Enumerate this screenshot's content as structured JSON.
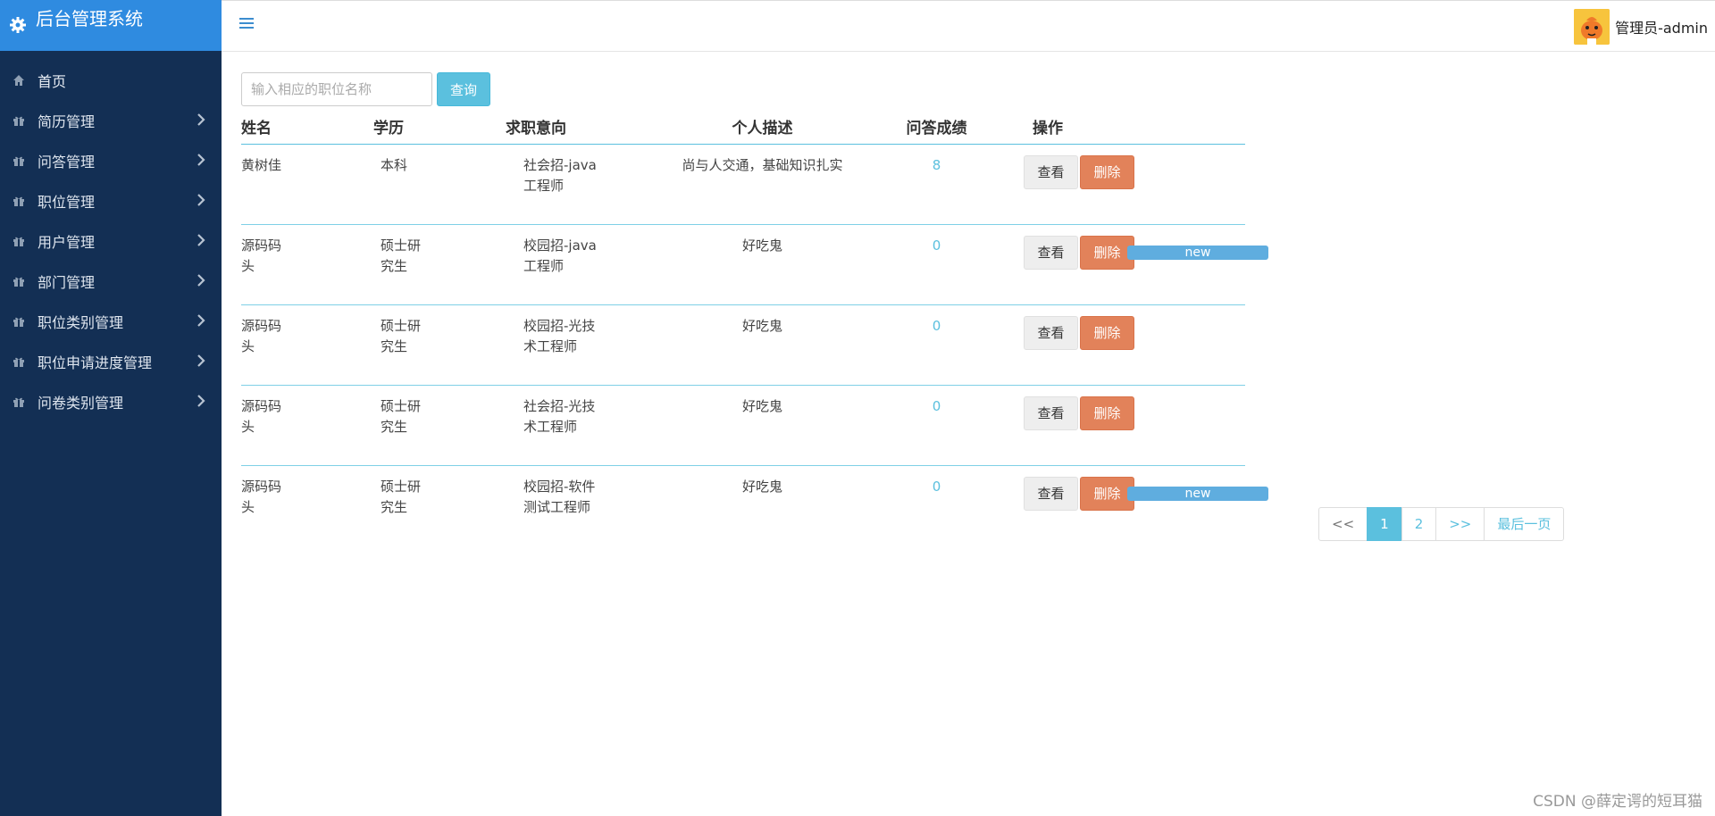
{
  "app": {
    "title": "后台管理系统"
  },
  "sidebar": {
    "items": [
      {
        "label": "首页",
        "icon": "home-icon",
        "has_children": false
      },
      {
        "label": "简历管理",
        "icon": "gift-icon",
        "has_children": true
      },
      {
        "label": "问答管理",
        "icon": "gift-icon",
        "has_children": true
      },
      {
        "label": "职位管理",
        "icon": "gift-icon",
        "has_children": true
      },
      {
        "label": "用户管理",
        "icon": "gift-icon",
        "has_children": true
      },
      {
        "label": "部门管理",
        "icon": "gift-icon",
        "has_children": true
      },
      {
        "label": "职位类别管理",
        "icon": "gift-icon",
        "has_children": true
      },
      {
        "label": "职位申请进度管理",
        "icon": "gift-icon",
        "has_children": true
      },
      {
        "label": "问卷类别管理",
        "icon": "gift-icon",
        "has_children": true
      }
    ]
  },
  "header": {
    "user_label": "管理员-admin",
    "menu_icon": "hamburger-icon"
  },
  "search": {
    "placeholder": "输入相应的职位名称",
    "value": "",
    "button_label": "查询"
  },
  "table": {
    "columns": [
      "姓名",
      "学历",
      "求职意向",
      "个人描述",
      "问答成绩",
      "操作"
    ],
    "view_label": "查看",
    "delete_label": "删除",
    "badge_label": "new",
    "rows": [
      {
        "name": "黄树佳",
        "education": "本科",
        "intention": "社会招-java工程师",
        "description": "尚与人交通，基础知识扎实",
        "score": "8",
        "is_new": false
      },
      {
        "name": "源码码头",
        "education": "硕士研究生",
        "intention": "校园招-java工程师",
        "description": "好吃鬼",
        "score": "0",
        "is_new": true
      },
      {
        "name": "源码码头",
        "education": "硕士研究生",
        "intention": "校园招-光技术工程师",
        "description": "好吃鬼",
        "score": "0",
        "is_new": false
      },
      {
        "name": "源码码头",
        "education": "硕士研究生",
        "intention": "社会招-光技术工程师",
        "description": "好吃鬼",
        "score": "0",
        "is_new": false
      },
      {
        "name": "源码码头",
        "education": "硕士研究生",
        "intention": "校园招-软件测试工程师",
        "description": "好吃鬼",
        "score": "0",
        "is_new": true
      }
    ]
  },
  "pagination": {
    "prev": "<<",
    "pages": [
      "1",
      "2"
    ],
    "current": "1",
    "next": ">>",
    "last": "最后一页"
  },
  "watermark": "CSDN @薛定谔的短耳猫",
  "colors": {
    "sidebar_bg": "#132f54",
    "brand_bg": "#2f8be0",
    "accent": "#5bc0de",
    "delete": "#e2825a",
    "badge": "#5faddf"
  }
}
